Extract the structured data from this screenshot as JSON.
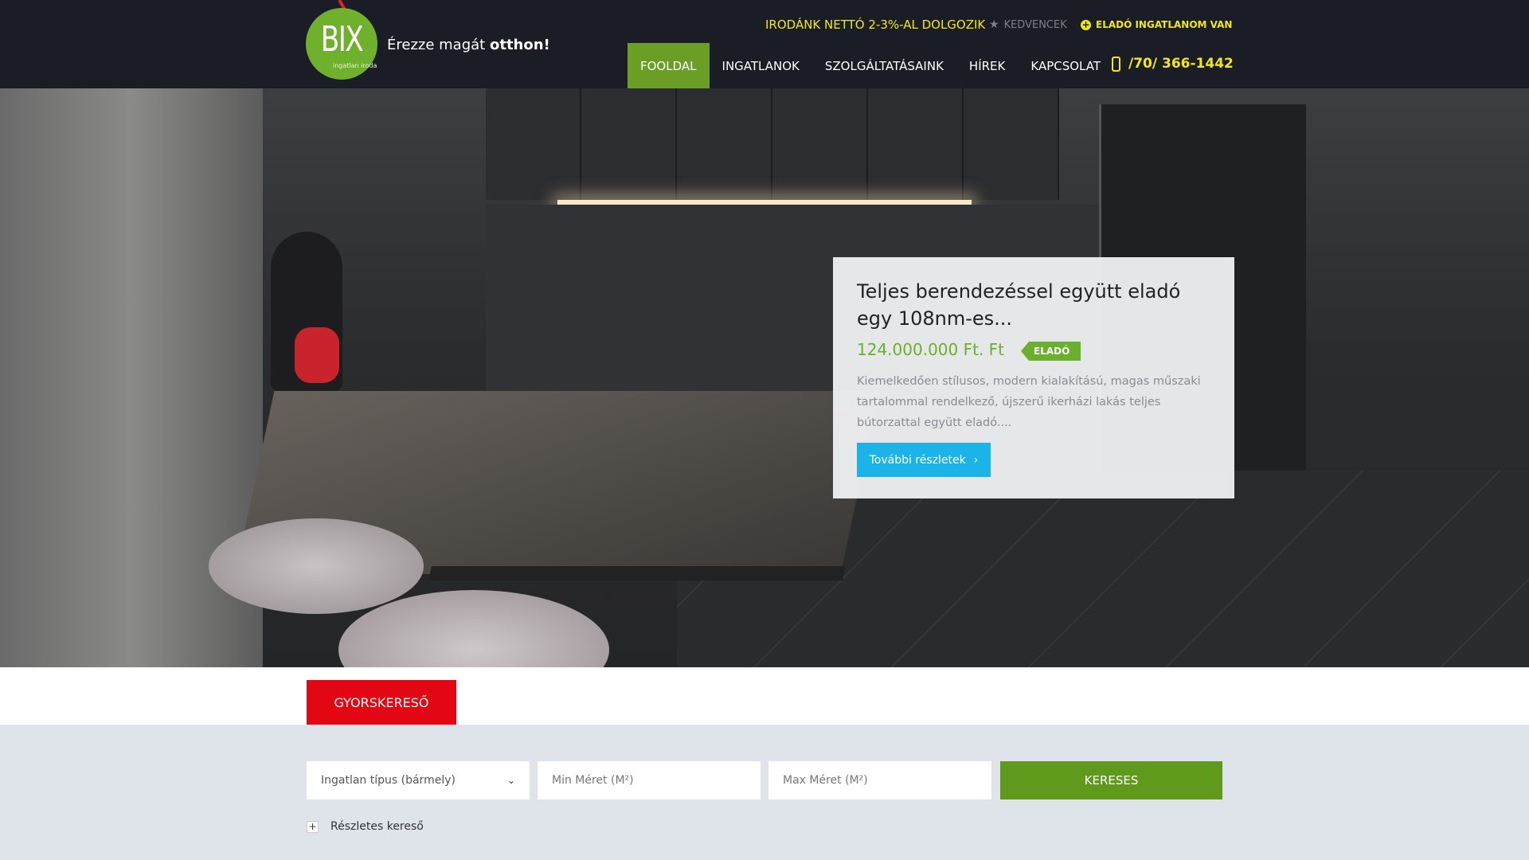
{
  "header": {
    "logo_text": "BIX",
    "logo_sub": "ingatlan iroda",
    "tagline_prefix": "Érezze magát",
    "tagline_bold": "otthon!",
    "promo": "IRODÁNK NETTÓ 2-3%-AL DOLGOZIK",
    "favorites": "KEDVENCEK",
    "sell": "ELADÓ INGATLANOM VAN",
    "phone": "/70/ 366-1442",
    "nav": [
      {
        "label": "FOOLDAL",
        "active": true
      },
      {
        "label": "INGATLANOK"
      },
      {
        "label": "SZOLGÁLTATÁSAINK"
      },
      {
        "label": "HÍREK"
      },
      {
        "label": "KAPCSOLAT"
      }
    ]
  },
  "hero_card": {
    "title": "Teljes berendezéssel együtt eladó egy 108nm-es...",
    "price": "124.000.000 Ft. Ft",
    "badge": "ELADÓ",
    "description": "Kiemelkedően stílusos, modern kialakítású, magas műszaki tartalommal rendelkező, újszerű ikerházi lakás teljes bútorzattal együtt eladó....",
    "button": "További részletek"
  },
  "quick_search": {
    "tab": "GYORSKERESŐ",
    "type_value": "Ingatlan típus (bármely)",
    "min_placeholder": "Min Méret (M²)",
    "max_placeholder": "Max Méret (M²)",
    "search_button": "KERESES",
    "detailed": "Részletes kereső"
  },
  "colors": {
    "header_bg": "#1a1d26",
    "accent_green": "#6a9e25",
    "accent_yellow": "#f1e81a",
    "red": "#e30613",
    "blue": "#1bb3e8"
  }
}
